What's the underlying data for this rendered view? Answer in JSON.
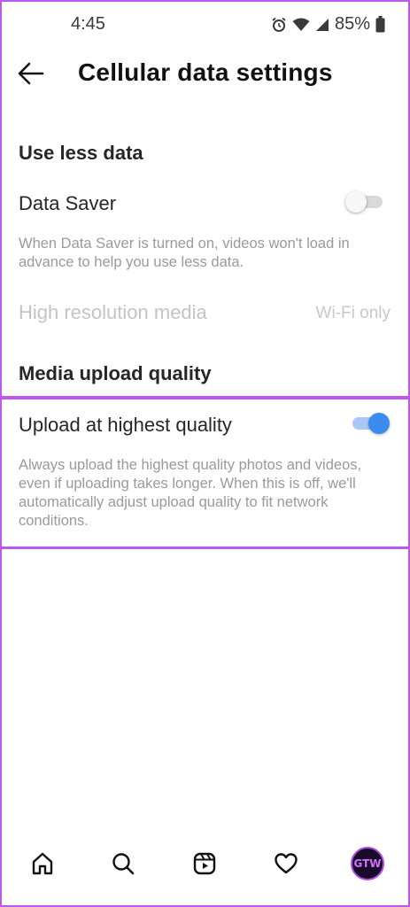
{
  "status_bar": {
    "time": "4:45",
    "battery": "85%"
  },
  "header": {
    "title": "Cellular data settings"
  },
  "use_less_data": {
    "section_title": "Use less data",
    "data_saver": {
      "label": "Data Saver",
      "enabled": false,
      "description": "When Data Saver is turned on, videos won't load in advance to help you use less data."
    },
    "high_res_media": {
      "label": "High resolution media",
      "value": "Wi-Fi only"
    }
  },
  "media_upload": {
    "section_title": "Media upload quality",
    "upload_highest": {
      "label": "Upload at highest quality",
      "enabled": true,
      "description": "Always upload the highest quality photos and videos, even if uploading takes longer. When this is off, we'll automatically adjust upload quality to fit network conditions."
    }
  },
  "bottom_nav": {
    "items": [
      "home-icon",
      "search-icon",
      "reels-icon",
      "heart-icon",
      "profile-avatar"
    ],
    "avatar_text": "GTW"
  },
  "colors": {
    "accent": "#3b8cf0",
    "frame": "#c058f0"
  }
}
